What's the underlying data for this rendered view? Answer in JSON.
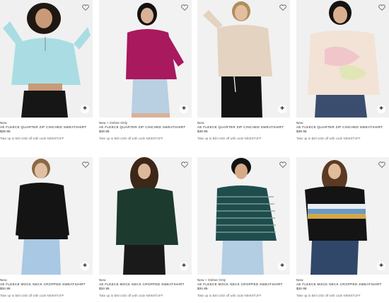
{
  "products": [
    {
      "badge": "New",
      "title": "AE Fleece Quarter Zip Cinched Sweatshirt",
      "price": "$39.95",
      "promo": "Take up to $40 USD off with code NEWSTUFF",
      "colors": {
        "top": "#a9dde3",
        "bottom": "#161616",
        "hair": "#1e1712",
        "bg": "#f0f0f0",
        "skin": "#c99a78"
      }
    },
    {
      "badge": "New + Online Only",
      "title": "AE Fleece Quarter Zip Cinched Sweatshirt",
      "price": "$39.95",
      "promo": "Take up to $40 USD off with code NEWSTUFF",
      "colors": {
        "top": "#a8195e",
        "bottom": "#b9cfe2",
        "hair": "#121212",
        "bg": "#f2f2f2",
        "skin": "#d9b196"
      }
    },
    {
      "badge": "New",
      "title": "AE Fleece Quarter Zip Cinched Sweatshirt",
      "price": "$39.95",
      "promo": "Take up to $40 USD off with code NEWSTUFF",
      "colors": {
        "top": "#e4d3c0",
        "bottom": "#141414",
        "hair": "#b08d5c",
        "bg": "#f1f1f1",
        "skin": "#e2bfa0"
      }
    },
    {
      "badge": "New",
      "title": "AE Fleece Quarter Zip Cinched Sweatshirt",
      "price": "$39.95",
      "promo": "Take up to $40 USD off with code NEWSTUFF",
      "colors": {
        "top": "#f2e3d6",
        "bottom": "#3a4d6e",
        "hair": "#141414",
        "bg": "#f0f0f0",
        "skin": "#dcb08e"
      }
    },
    {
      "badge": "New",
      "title": "AE Fleece Mock Neck Cropped Sweatshirt",
      "price": "$34.95",
      "promo": "Take up to $40 USD off with code NEWSTUFF",
      "colors": {
        "top": "#141414",
        "bottom": "#a9c8e4",
        "hair": "#8a6a44",
        "bg": "#f2f2f2",
        "skin": "#e0bfa2"
      }
    },
    {
      "badge": "New",
      "title": "AE Fleece Mock Neck Cropped Sweatshirt",
      "price": "$34.95",
      "promo": "Take up to $40 USD off with code NEWSTUFF",
      "colors": {
        "top": "#1d3a2e",
        "bottom": "#1a1a1a",
        "hair": "#3d2718",
        "bg": "#f2f2f2",
        "skin": "#deb89b"
      }
    },
    {
      "badge": "New + Online Only",
      "title": "AE Fleece Mock Neck Cropped Sweatshirt",
      "price": "$34.95",
      "promo": "Take up to $40 USD off with code NEWSTUFF",
      "colors": {
        "top": "#1f4d4e",
        "bottom": "#b3cde3",
        "hair": "#121212",
        "bg": "#f2f2f2",
        "skin": "#d6a988"
      }
    },
    {
      "badge": "New",
      "title": "AE Fleece Mock Neck Cropped Sweatshirt",
      "price": "$34.95",
      "promo": "Take up to $40 USD off with code NEWSTUFF",
      "colors": {
        "top": "#141414",
        "bottom": "#30476a",
        "hair": "#5a3a22",
        "bg": "#f2f2f2",
        "skin": "#e0bb9c"
      }
    }
  ],
  "icons": {
    "favorite": "heart-icon",
    "quick_add": "plus-icon"
  }
}
